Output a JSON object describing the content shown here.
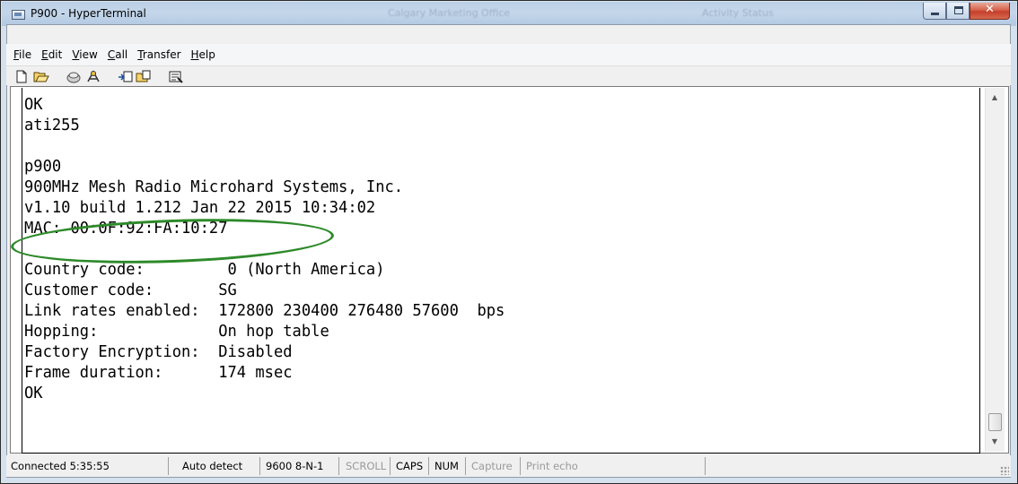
{
  "window": {
    "title": "P900 - HyperTerminal",
    "background_titles": [
      "Calgary Marketing Office",
      "Activity Status"
    ]
  },
  "menu": {
    "items": [
      {
        "key": "F",
        "rest": "ile"
      },
      {
        "key": "E",
        "rest": "dit"
      },
      {
        "key": "V",
        "rest": "iew"
      },
      {
        "key": "C",
        "rest": "all"
      },
      {
        "key": "T",
        "rest": "ransfer"
      },
      {
        "key": "H",
        "rest": "elp"
      }
    ]
  },
  "toolbar": {
    "icons": [
      "new-icon",
      "open-icon",
      "connect-icon",
      "disconnect-icon",
      "send-icon",
      "receive-icon",
      "properties-icon"
    ]
  },
  "terminal": {
    "lines": [
      "OK",
      "ati255",
      "",
      "p900",
      "900MHz Mesh Radio Microhard Systems, Inc.",
      "v1.10 build 1.212 Jan 22 2015 10:34:02",
      "MAC: 00:0F:92:FA:10:27",
      "",
      "Country code:         0 (North America)",
      "Customer code:       SG",
      "Link rates enabled:  172800 230400 276480 57600  bps",
      "Hopping:             On hop table",
      "Factory Encryption:  Disabled",
      "Frame duration:      174 msec",
      "OK"
    ]
  },
  "status": {
    "connected": "Connected 5:35:55",
    "detect": "Auto detect",
    "settings": "9600 8-N-1",
    "scroll": "SCROLL",
    "caps": "CAPS",
    "num": "NUM",
    "capture": "Capture",
    "print_echo": "Print echo"
  },
  "colors": {
    "annotation": "#2d8a2a",
    "close_button": "#c5402b"
  }
}
